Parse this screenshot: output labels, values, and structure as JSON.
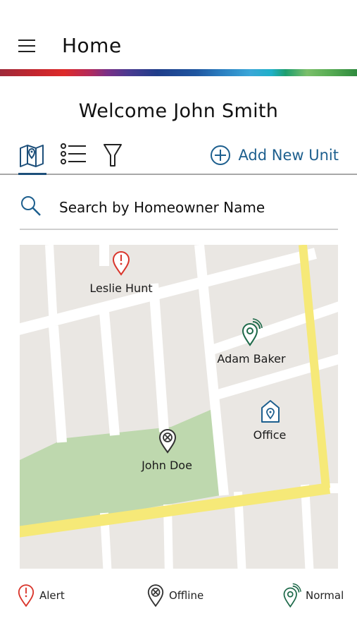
{
  "header": {
    "title": "Home"
  },
  "welcome": "Welcome John Smith",
  "toolbar": {
    "add_label": "Add New Unit"
  },
  "search": {
    "placeholder": "Search by Homeowner Name"
  },
  "map": {
    "pins": [
      {
        "name": "Leslie Hunt",
        "status": "alert"
      },
      {
        "name": "Adam Baker",
        "status": "normal"
      },
      {
        "name": "Office",
        "status": "office"
      },
      {
        "name": "John Doe",
        "status": "offline"
      }
    ]
  },
  "legend": {
    "alert": "Alert",
    "offline": "Offline",
    "normal": "Normal"
  },
  "colors": {
    "alert": "#d9352b",
    "normal": "#1e6a4a",
    "office": "#1d5f8e",
    "offline": "#333333",
    "accent": "#1d5f8e"
  }
}
